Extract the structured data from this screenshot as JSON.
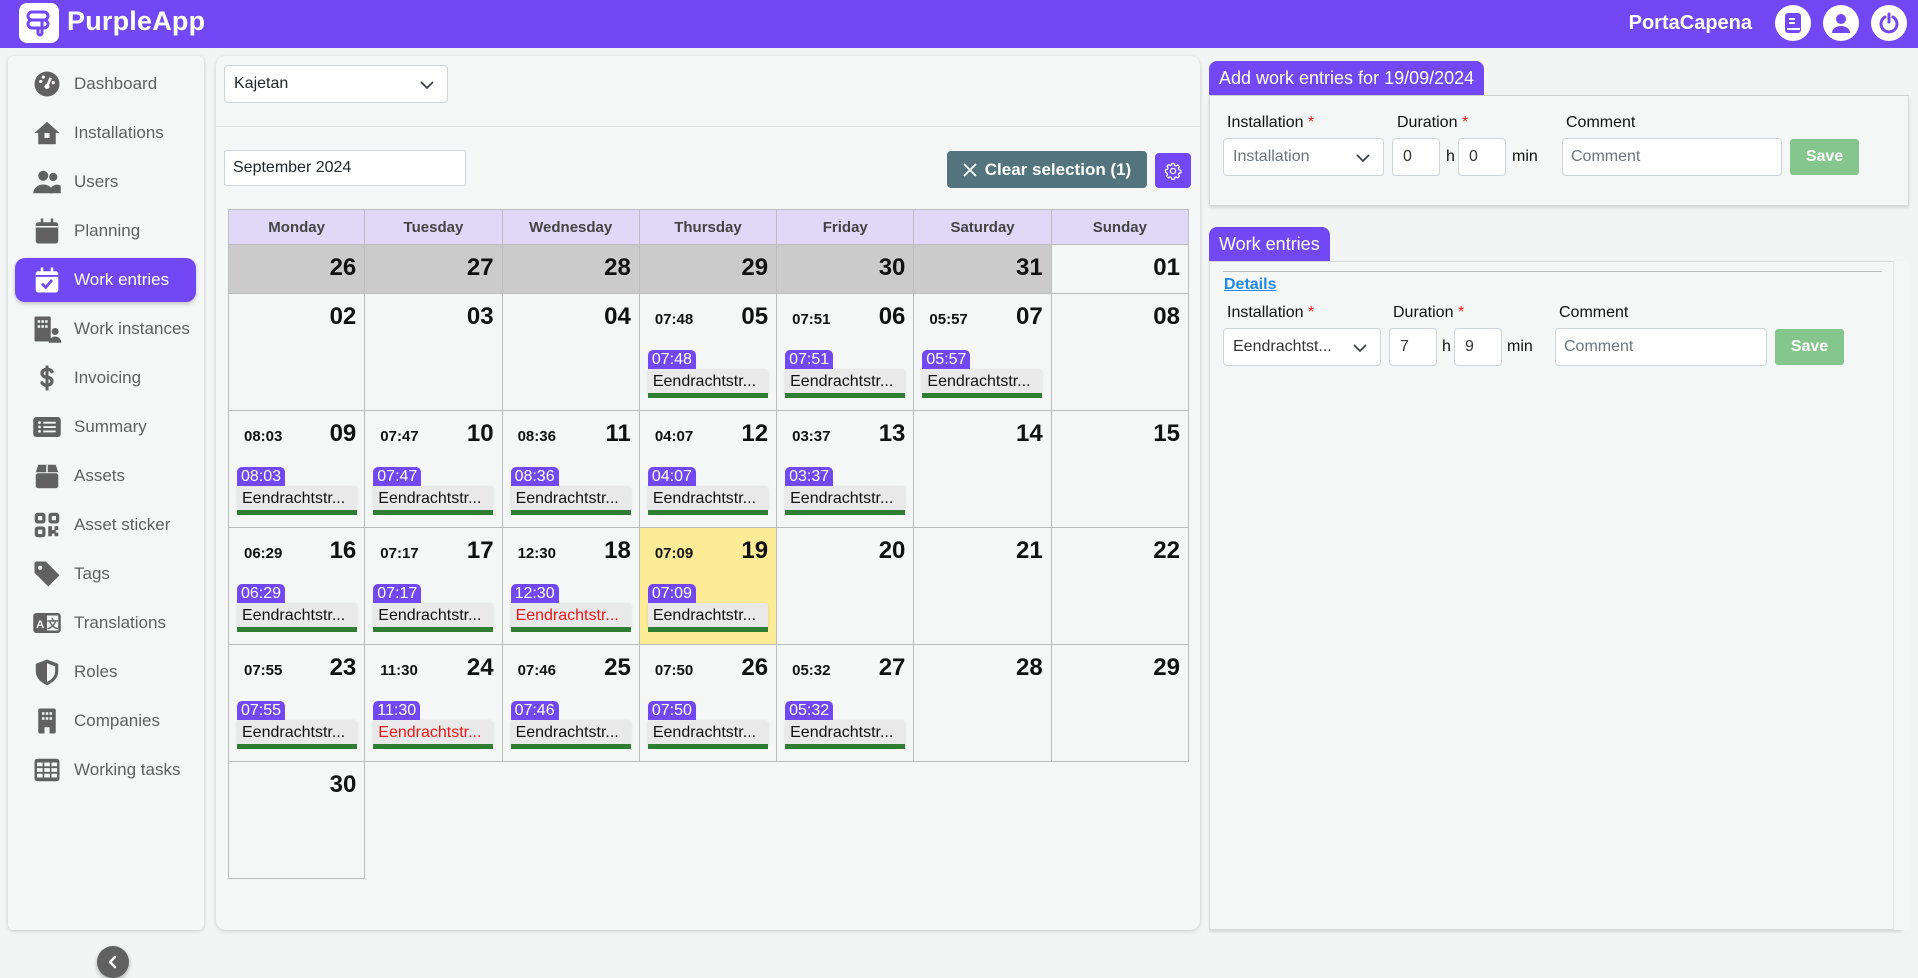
{
  "header": {
    "app_name": "PurpleApp",
    "company": "PortaCapena",
    "icons": [
      "book-icon",
      "user-icon",
      "power-icon"
    ]
  },
  "sidebar": {
    "items": [
      {
        "label": "Dashboard",
        "icon": "gauge-icon",
        "active": false
      },
      {
        "label": "Installations",
        "icon": "house-icon",
        "active": false
      },
      {
        "label": "Users",
        "icon": "users-icon",
        "active": false
      },
      {
        "label": "Planning",
        "icon": "calendar-icon",
        "active": false
      },
      {
        "label": "Work entries",
        "icon": "calendar-check-icon",
        "active": true
      },
      {
        "label": "Work instances",
        "icon": "building-user-icon",
        "active": false
      },
      {
        "label": "Invoicing",
        "icon": "dollar-icon",
        "active": false
      },
      {
        "label": "Summary",
        "icon": "list-icon",
        "active": false
      },
      {
        "label": "Assets",
        "icon": "box-icon",
        "active": false
      },
      {
        "label": "Asset sticker",
        "icon": "qrcode-icon",
        "active": false
      },
      {
        "label": "Tags",
        "icon": "tag-icon",
        "active": false
      },
      {
        "label": "Translations",
        "icon": "language-icon",
        "active": false
      },
      {
        "label": "Roles",
        "icon": "shield-icon",
        "active": false
      },
      {
        "label": "Companies",
        "icon": "building-icon",
        "active": false
      },
      {
        "label": "Working tasks",
        "icon": "table-cells-icon",
        "active": false
      }
    ],
    "collapse_icon": "chevron-left-icon"
  },
  "calendar": {
    "user_select": "Kajetan",
    "month": "September 2024",
    "clear_selection": "Clear selection (1)",
    "weekdays": [
      "Monday",
      "Tuesday",
      "Wednesday",
      "Thursday",
      "Friday",
      "Saturday",
      "Sunday"
    ],
    "weeks": [
      [
        {
          "day": "26",
          "other": true
        },
        {
          "day": "27",
          "other": true
        },
        {
          "day": "28",
          "other": true
        },
        {
          "day": "29",
          "other": true
        },
        {
          "day": "30",
          "other": true
        },
        {
          "day": "31",
          "other": true
        },
        {
          "day": "01"
        }
      ],
      [
        {
          "day": "02"
        },
        {
          "day": "03"
        },
        {
          "day": "04"
        },
        {
          "day": "05",
          "total": "07:48",
          "entry": {
            "time": "07:48",
            "name": "Eendrachtstr..."
          }
        },
        {
          "day": "06",
          "total": "07:51",
          "entry": {
            "time": "07:51",
            "name": "Eendrachtstr..."
          }
        },
        {
          "day": "07",
          "total": "05:57",
          "entry": {
            "time": "05:57",
            "name": "Eendrachtstr..."
          }
        },
        {
          "day": "08"
        }
      ],
      [
        {
          "day": "09",
          "total": "08:03",
          "entry": {
            "time": "08:03",
            "name": "Eendrachtstr..."
          }
        },
        {
          "day": "10",
          "total": "07:47",
          "entry": {
            "time": "07:47",
            "name": "Eendrachtstr..."
          }
        },
        {
          "day": "11",
          "total": "08:36",
          "entry": {
            "time": "08:36",
            "name": "Eendrachtstr..."
          }
        },
        {
          "day": "12",
          "total": "04:07",
          "entry": {
            "time": "04:07",
            "name": "Eendrachtstr..."
          }
        },
        {
          "day": "13",
          "total": "03:37",
          "entry": {
            "time": "03:37",
            "name": "Eendrachtstr..."
          }
        },
        {
          "day": "14"
        },
        {
          "day": "15"
        }
      ],
      [
        {
          "day": "16",
          "total": "06:29",
          "entry": {
            "time": "06:29",
            "name": "Eendrachtstr..."
          }
        },
        {
          "day": "17",
          "total": "07:17",
          "entry": {
            "time": "07:17",
            "name": "Eendrachtstr..."
          }
        },
        {
          "day": "18",
          "total": "12:30",
          "entry": {
            "time": "12:30",
            "name": "Eendrachtstr...",
            "warn": true
          }
        },
        {
          "day": "19",
          "total": "07:09",
          "selected": true,
          "entry": {
            "time": "07:09",
            "name": "Eendrachtstr..."
          }
        },
        {
          "day": "20"
        },
        {
          "day": "21"
        },
        {
          "day": "22"
        }
      ],
      [
        {
          "day": "23",
          "total": "07:55",
          "entry": {
            "time": "07:55",
            "name": "Eendrachtstr..."
          }
        },
        {
          "day": "24",
          "total": "11:30",
          "entry": {
            "time": "11:30",
            "name": "Eendrachtstr...",
            "warn": true
          }
        },
        {
          "day": "25",
          "total": "07:46",
          "entry": {
            "time": "07:46",
            "name": "Eendrachtstr..."
          }
        },
        {
          "day": "26",
          "total": "07:50",
          "entry": {
            "time": "07:50",
            "name": "Eendrachtstr..."
          }
        },
        {
          "day": "27",
          "total": "05:32",
          "entry": {
            "time": "05:32",
            "name": "Eendrachtstr..."
          }
        },
        {
          "day": "28"
        },
        {
          "day": "29"
        }
      ],
      [
        {
          "day": "30"
        }
      ]
    ]
  },
  "add_form": {
    "title": "Add work entries for 19/09/2024",
    "installation_label": "Installation",
    "installation_placeholder": "Installation",
    "duration_label": "Duration",
    "hours": "0",
    "minutes": "0",
    "hours_unit": "h",
    "minutes_unit": "min",
    "comment_label": "Comment",
    "comment_placeholder": "Comment",
    "save": "Save",
    "required_mark": "*"
  },
  "work_entries": {
    "title": "Work entries",
    "details_link": "Details",
    "installation_label": "Installation",
    "installation_value": "Eendrachtst...",
    "duration_label": "Duration",
    "hours": "7",
    "minutes": "9",
    "hours_unit": "h",
    "minutes_unit": "min",
    "comment_label": "Comment",
    "comment_placeholder": "Comment",
    "save": "Save",
    "required_mark": "*"
  },
  "colors": {
    "brand": "#7247f4",
    "clear_button": "#53737d",
    "save_button": "#85c68c",
    "entry_ok_bar": "#2e7d32",
    "entry_warn_text": "#e8191b",
    "selected_day": "#fcec98",
    "other_month_day": "#cbcbcb",
    "weekday_header": "#dfd9f7"
  }
}
